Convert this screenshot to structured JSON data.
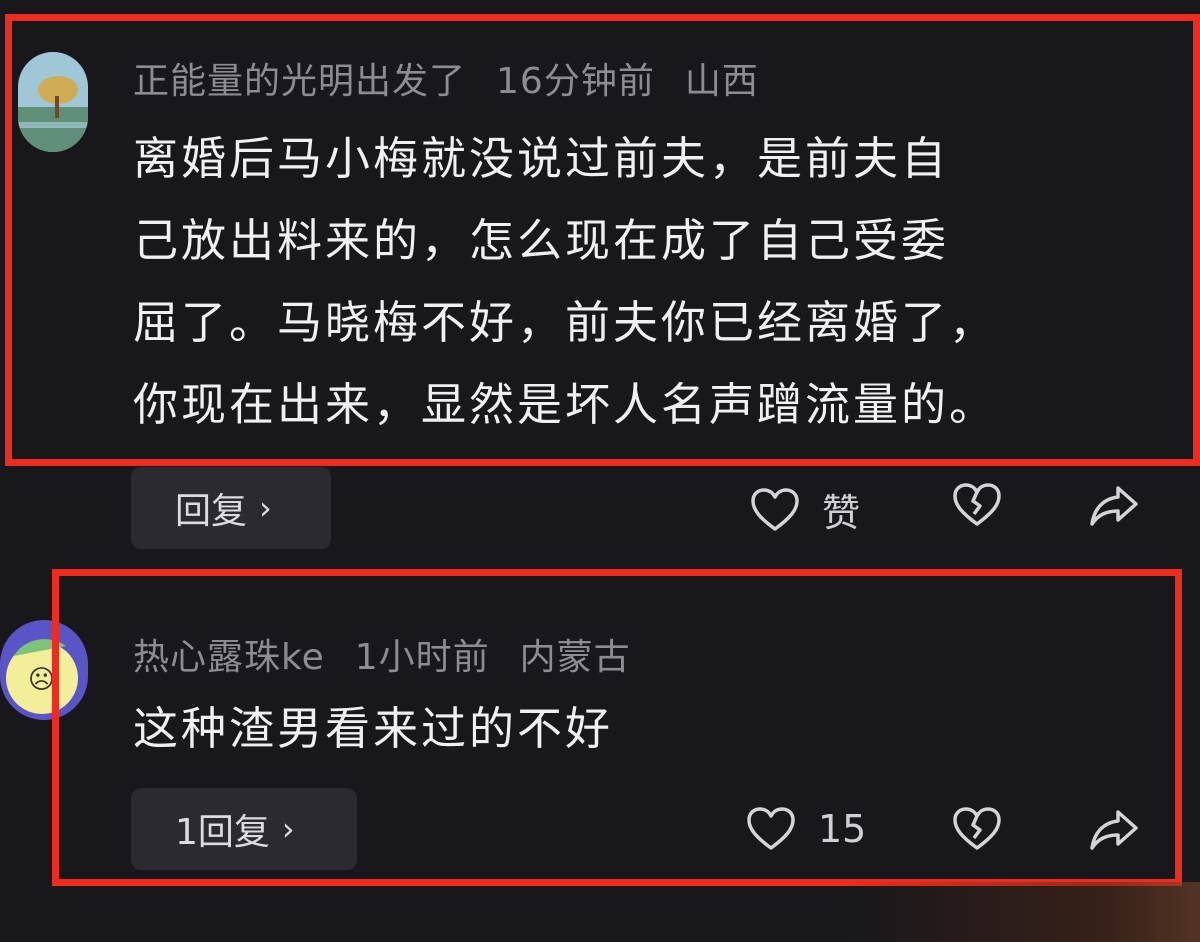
{
  "comments": [
    {
      "username": "正能量的光明出发了",
      "time": "16分钟前",
      "location": "山西",
      "text_lines": [
        "离婚后马小梅就没说过前夫，是前夫自",
        "己放出料来的，怎么现在成了自己受委",
        "屈了。马晓梅不好，前夫你已经离婚了，",
        "你现在出来，显然是坏人名声蹭流量的。"
      ],
      "reply_label": "回复",
      "like_label": "赞",
      "avatar_icon": "landscape-avatar"
    },
    {
      "username": "热心露珠ke",
      "time": "1小时前",
      "location": "内蒙古",
      "text_lines": [
        "这种渣男看来过的不好"
      ],
      "reply_label": "1回复",
      "like_label": "15",
      "avatar_icon": "cartoon-face-avatar"
    }
  ],
  "icons": {
    "like": "heart-icon",
    "dislike": "broken-heart-icon",
    "share": "share-arrow-icon",
    "chevron": "chevron-right-icon"
  },
  "colors": {
    "highlight_box": "#ef2b20",
    "background": "#17171c"
  }
}
